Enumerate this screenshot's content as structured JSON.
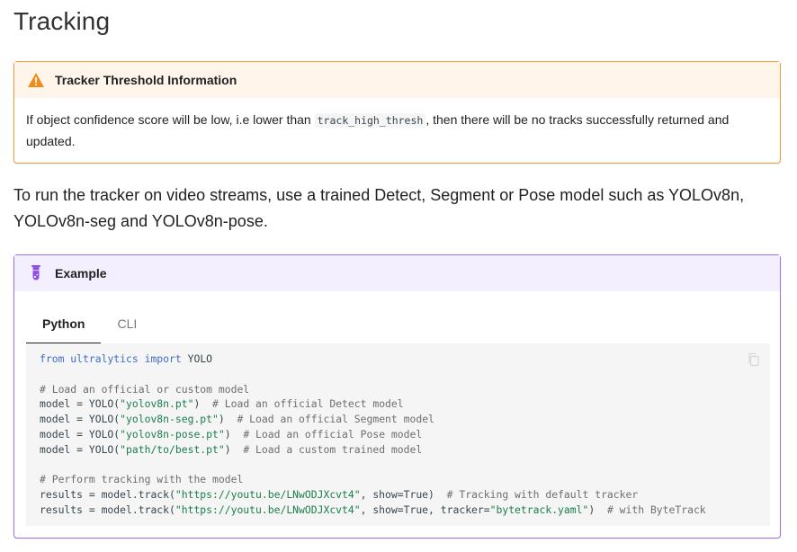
{
  "page": {
    "title": "Tracking"
  },
  "warning": {
    "icon": "warning-triangle-icon",
    "title": "Tracker Threshold Information",
    "text_before": "If object confidence score will be low, i.e lower than ",
    "code": "track_high_thresh",
    "text_after": ", then there will be no tracks successfully returned and updated."
  },
  "intro": "To run the tracker on video streams, use a trained Detect, Segment or Pose model such as YOLOv8n, YOLOv8n-seg and YOLOv8n-pose.",
  "example": {
    "icon": "flask-icon",
    "title": "Example",
    "tabs": [
      {
        "label": "Python",
        "active": true
      },
      {
        "label": "CLI",
        "active": false
      }
    ],
    "code_lines": [
      [
        {
          "t": "from",
          "c": "kw"
        },
        {
          "t": " "
        },
        {
          "t": "ultralytics",
          "c": "kw"
        },
        {
          "t": " "
        },
        {
          "t": "import",
          "c": "kw"
        },
        {
          "t": " YOLO"
        }
      ],
      [],
      [
        {
          "t": "# Load an official or custom model",
          "c": "cm"
        }
      ],
      [
        {
          "t": "model = YOLO("
        },
        {
          "t": "\"yolov8n.pt\"",
          "c": "str"
        },
        {
          "t": ")  "
        },
        {
          "t": "# Load an official Detect model",
          "c": "cm"
        }
      ],
      [
        {
          "t": "model = YOLO("
        },
        {
          "t": "\"yolov8n-seg.pt\"",
          "c": "str"
        },
        {
          "t": ")  "
        },
        {
          "t": "# Load an official Segment model",
          "c": "cm"
        }
      ],
      [
        {
          "t": "model = YOLO("
        },
        {
          "t": "\"yolov8n-pose.pt\"",
          "c": "str"
        },
        {
          "t": ")  "
        },
        {
          "t": "# Load an official Pose model",
          "c": "cm"
        }
      ],
      [
        {
          "t": "model = YOLO("
        },
        {
          "t": "\"path/to/best.pt\"",
          "c": "str"
        },
        {
          "t": ")  "
        },
        {
          "t": "# Load a custom trained model",
          "c": "cm"
        }
      ],
      [],
      [
        {
          "t": "# Perform tracking with the model",
          "c": "cm"
        }
      ],
      [
        {
          "t": "results = model.track("
        },
        {
          "t": "\"https://youtu.be/LNwODJXcvt4\"",
          "c": "str"
        },
        {
          "t": ", show=True)  "
        },
        {
          "t": "# Tracking with default tracker",
          "c": "cm"
        }
      ],
      [
        {
          "t": "results = model.track("
        },
        {
          "t": "\"https://youtu.be/LNwODJXcvt4\"",
          "c": "str"
        },
        {
          "t": ", show=True, tracker="
        },
        {
          "t": "\"bytetrack.yaml\"",
          "c": "str"
        },
        {
          "t": ")  "
        },
        {
          "t": "# with ByteTrack",
          "c": "cm"
        }
      ]
    ],
    "copy_icon": "copy-icon"
  }
}
